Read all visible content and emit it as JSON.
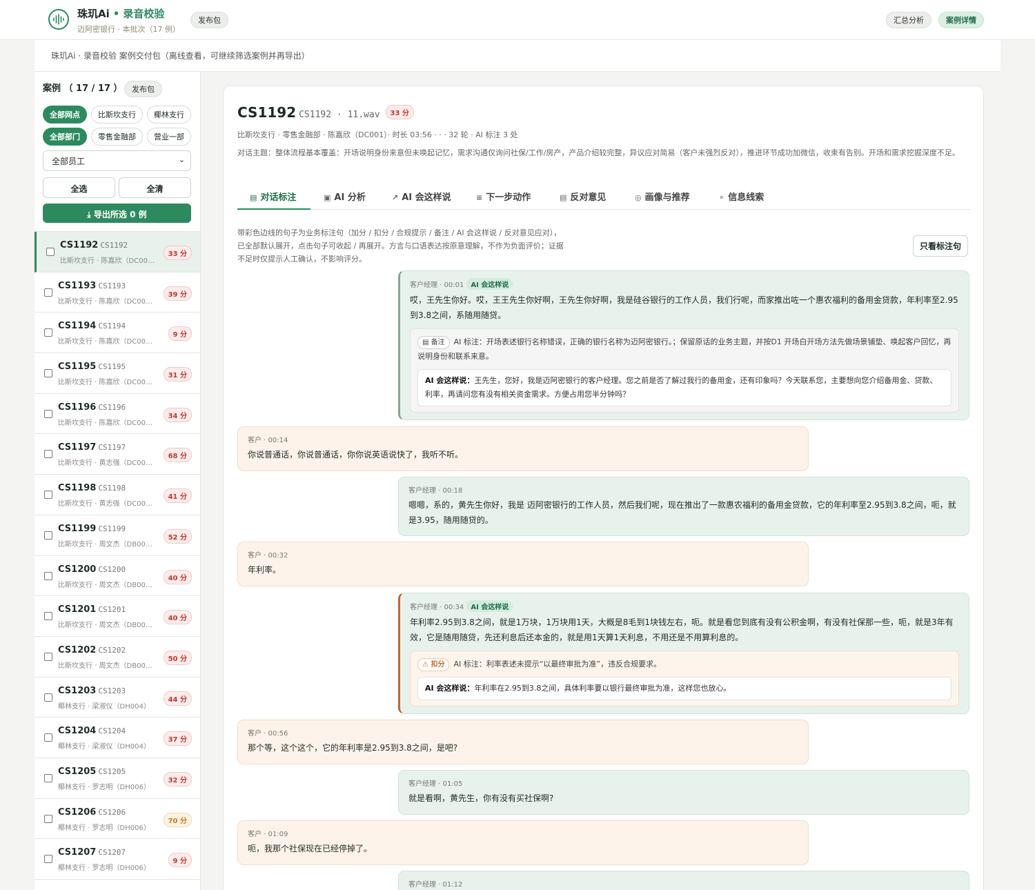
{
  "header": {
    "brand": "珠玑Ai",
    "sep": "•",
    "product": "录音校验",
    "bank_line": "迈阿密银行 · 本批次（17 例）",
    "release_pill": "发布包",
    "nav_summary": "汇总分析",
    "nav_detail": "案例详情"
  },
  "subbar": "珠玑Ai · 录音校验 案例交付包（离线查看，可继续筛选案例并再导出）",
  "sidebar": {
    "title": "案例 （ 17 / 17 ）",
    "title_pill": "发布包",
    "branch_chips": [
      "全部网点",
      "比斯坎支行",
      "椰林支行"
    ],
    "dept_chips": [
      "全部部门",
      "零售金融部",
      "营业一部"
    ],
    "employee_select": "全部员工",
    "select_all": "全选",
    "clear_all": "全清",
    "export": "⤓  导出所选 0 例"
  },
  "cases": [
    {
      "id": "CS1192",
      "code": "CS1192",
      "meta": "比斯坎支行 · 陈嘉欣（DC001）",
      "score": "33 分",
      "level": "low"
    },
    {
      "id": "CS1193",
      "code": "CS1193",
      "meta": "比斯坎支行 · 陈嘉欣（DC001）",
      "score": "39 分",
      "level": "low"
    },
    {
      "id": "CS1194",
      "code": "CS1194",
      "meta": "比斯坎支行 · 陈嘉欣（DC001）",
      "score": "9 分",
      "level": "low"
    },
    {
      "id": "CS1195",
      "code": "CS1195",
      "meta": "比斯坎支行 · 陈嘉欣（DC001）",
      "score": "31 分",
      "level": "low"
    },
    {
      "id": "CS1196",
      "code": "CS1196",
      "meta": "比斯坎支行 · 陈嘉欣（DC001）",
      "score": "34 分",
      "level": "low"
    },
    {
      "id": "CS1197",
      "code": "CS1197",
      "meta": "比斯坎支行 · 黄志强（DC002）",
      "score": "68 分",
      "level": "low"
    },
    {
      "id": "CS1198",
      "code": "CS1198",
      "meta": "比斯坎支行 · 黄志强（DC002）",
      "score": "41 分",
      "level": "low"
    },
    {
      "id": "CS1199",
      "code": "CS1199",
      "meta": "比斯坎支行 · 周文杰（DB003）",
      "score": "52 分",
      "level": "low"
    },
    {
      "id": "CS1200",
      "code": "CS1200",
      "meta": "比斯坎支行 · 周文杰（DB003）",
      "score": "40 分",
      "level": "low"
    },
    {
      "id": "CS1201",
      "code": "CS1201",
      "meta": "比斯坎支行 · 周文杰（DB003）",
      "score": "40 分",
      "level": "low"
    },
    {
      "id": "CS1202",
      "code": "CS1202",
      "meta": "比斯坎支行 · 周文杰（DB003）",
      "score": "50 分",
      "level": "low"
    },
    {
      "id": "CS1203",
      "code": "CS1203",
      "meta": "椰林支行 · 梁淑仪（DH004）",
      "score": "44 分",
      "level": "low"
    },
    {
      "id": "CS1204",
      "code": "CS1204",
      "meta": "椰林支行 · 梁淑仪（DH004）",
      "score": "37 分",
      "level": "low"
    },
    {
      "id": "CS1205",
      "code": "CS1205",
      "meta": "椰林支行 · 罗志明（DH006）",
      "score": "32 分",
      "level": "low"
    },
    {
      "id": "CS1206",
      "code": "CS1206",
      "meta": "椰林支行 · 罗志明（DH006）",
      "score": "70 分",
      "level": "mid"
    },
    {
      "id": "CS1207",
      "code": "CS1207",
      "meta": "椰林支行 · 罗志明（DH006）",
      "score": "9 分",
      "level": "low"
    }
  ],
  "detail": {
    "id": "CS1192",
    "file": "CS1192 · 11.wav",
    "score": "33 分",
    "meta": "比斯坎支行 · 零售金融部 · 陈嘉欣（DC001）· 时长 03:56 · · · 32 轮 · AI 标注 3 处",
    "topic": "对话主题：整体流程基本覆盖：开场说明身份来意但未唤起记忆，需求沟通仅询问社保/工作/房产，产品介绍较完整，异议应对简易（客户未强烈反对），推进环节成功加微信，收束有告别。开场和需求挖掘深度不足。",
    "tabs": [
      "对话标注",
      "AI 分析",
      "AI 会这样说",
      "下一步动作",
      "反对意见",
      "画像与推荐",
      "信息线索"
    ],
    "hint": "带彩色边线的句子为业务标注句（加分 / 扣分 / 合规提示 / 备注 / AI 会这样说 / 反对意见应对），已全部默认展开，点击句子可收起 / 再展开。方言与口语表达按原意理解，不作为负面评价；证据不足时仅提示人工确认，不影响评分。",
    "only_marked": "只看标注句"
  },
  "messages": [
    {
      "who": "客户经理 · 00:01",
      "tag": "AI 会这样说",
      "text": "哎，王先生你好。哎，王王先生你好啊，王先生你好啊，我是硅谷银行的工作人员，我们行呢，而家推出咗一个惠农福利的备用金贷款，年利率至2.95到3.8之间，系随用随贷。",
      "note_label": "备注",
      "note": "AI 标注：开场表述银行名称错误，正确的银行名称为迈阿密银行。；保留原话的业务主题，并按D1 开场白开场方法先做场景铺垫、唤起客户回忆，再说明身份和联系来意。",
      "say_label": "AI 会这样说：",
      "say": "王先生，您好，我是迈阿密银行的客户经理。您之前是否了解过我行的备用金，还有印象吗？今天联系您，主要想向您介绍备用金、贷款、利率，再请问您有没有相关资金需求。方便占用您半分钟吗？"
    },
    {
      "who": "客户 · 00:14",
      "text": "你说普通话，你说普通话，你你说英语说快了，我听不听。"
    },
    {
      "who": "客户经理 · 00:18",
      "text": "嗯嗯，系的，黄先生你好，我是 迈阿密银行的工作人员，然后我们呢，现在推出了一款惠农福利的备用金贷款，它的年利率至2.95到3.8之间，呃，就是3.95，随用随贷的。"
    },
    {
      "who": "客户 · 00:32",
      "text": "年利率。"
    },
    {
      "who": "客户经理 · 00:34",
      "tag": "AI 会这样说",
      "text": "年利率2.95到3.8之间，就是1万块，1万块用1天，大概是8毛到1块钱左右，呃。就是看您到底有没有公积金啊，有没有社保那一些，呃，就是3年有效，它是随用随贷，先还利息后还本金的，就是用1天算1天利息，不用还是不用算利息的。",
      "note_label": "扣分",
      "note": "AI 标注：利率表述未提示“以最终审批为准”，违反合规要求。",
      "say_label": "AI 会这样说：",
      "say": "年利率在2.95到3.8之间，具体利率要以银行最终审批为准，这样您也放心。"
    },
    {
      "who": "客户 · 00:56",
      "text": "那个等，这个这个，它的年利率是2.95到3.8之间，是吧?"
    },
    {
      "who": "客户经理 · 01:05",
      "text": "就是看啊，黄先生，你有没有买社保啊?"
    },
    {
      "who": "客户 · 01:09",
      "text": "呃，我那个社保现在已经停掉了。"
    },
    {
      "who": "客户经理 · 01:12"
    }
  ]
}
